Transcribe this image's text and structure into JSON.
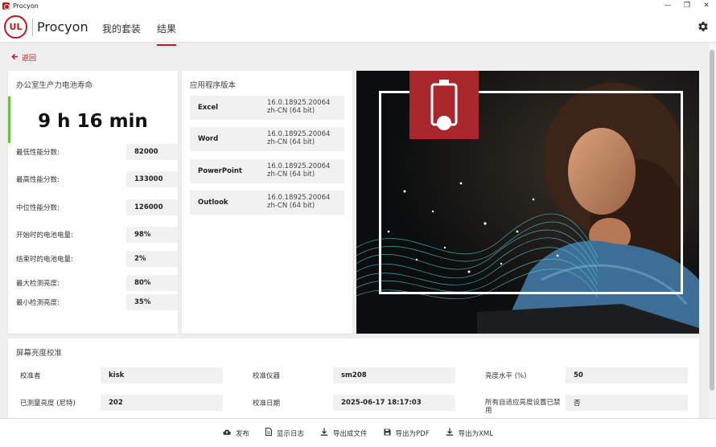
{
  "window": {
    "title": "Procyon",
    "minimize_glyph": "—",
    "restore_glyph": "❐",
    "close_glyph": "✕"
  },
  "header": {
    "logo_text": "UL",
    "brand": "Procyon",
    "tabs": [
      {
        "label": "我的套装",
        "active": false
      },
      {
        "label": "结果",
        "active": true
      }
    ],
    "settings_icon": "gear-icon"
  },
  "back": {
    "label": "返回",
    "icon": "arrow-left-icon"
  },
  "battery": {
    "title": "办公室生产力电池寿命",
    "result": "9 h 16 min",
    "accent_color": "#6cc04a",
    "stats": [
      {
        "label": "最低性能分数:",
        "value": "82000"
      },
      {
        "label": "最高性能分数:",
        "value": "133000"
      },
      {
        "label": "中位性能分数:",
        "value": "126000"
      },
      {
        "label": "开始时的电池电量:",
        "value": "98%"
      },
      {
        "label": "结束时的电池电量:",
        "value": "2%"
      },
      {
        "label": "最大检测亮度:",
        "value": "80%"
      },
      {
        "label": "最小检测亮度:",
        "value": "35%"
      }
    ]
  },
  "versions": {
    "title": "应用程序版本",
    "apps": [
      {
        "name": "Excel",
        "version_line1": "16.0.18925.20064",
        "version_line2": "zh-CN (64 bit)"
      },
      {
        "name": "Word",
        "version_line1": "16.0.18925.20064",
        "version_line2": "zh-CN (64 bit)"
      },
      {
        "name": "PowerPoint",
        "version_line1": "16.0.18925.20064",
        "version_line2": "zh-CN (64 bit)"
      },
      {
        "name": "Outlook",
        "version_line1": "16.0.18925.20064",
        "version_line2": "zh-CN (64 bit)"
      }
    ]
  },
  "hero": {
    "badge_icon": "battery-icon",
    "badge_color": "#a8272d"
  },
  "calibration": {
    "title": "屏幕亮度校准",
    "fields": [
      {
        "label": "校准者",
        "value": "kisk"
      },
      {
        "label": "校准仪器",
        "value": "sm208"
      },
      {
        "label": "亮度水平 (%)",
        "value": "50"
      },
      {
        "label": "已测量亮度 (尼特)",
        "value": "202"
      },
      {
        "label": "校准日期",
        "value": "2025-06-17 18:17:03"
      },
      {
        "label": "所有自适应亮度设置已禁用",
        "value": "否"
      }
    ]
  },
  "footer": {
    "buttons": [
      {
        "label": "发布",
        "icon": "cloud-upload-icon"
      },
      {
        "label": "显示日志",
        "icon": "document-icon"
      },
      {
        "label": "导出成文件",
        "icon": "download-icon"
      },
      {
        "label": "导出为PDF",
        "icon": "save-icon"
      },
      {
        "label": "导出为XML",
        "icon": "download-icon"
      }
    ]
  },
  "colors": {
    "accent_red": "#c4161c",
    "background": "#efefef"
  }
}
